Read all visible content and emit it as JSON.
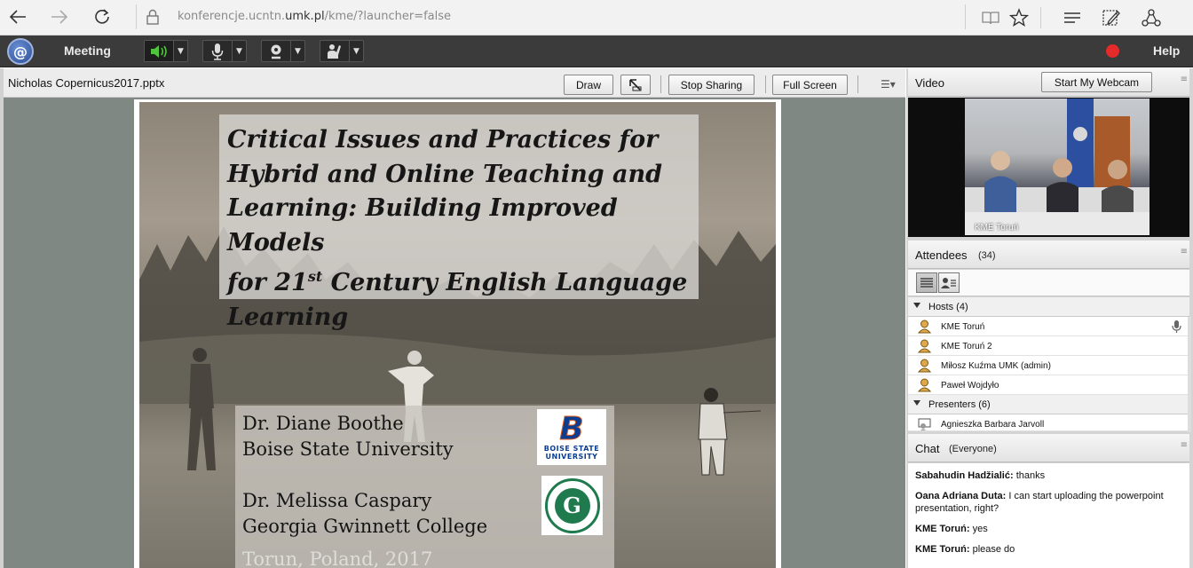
{
  "browser": {
    "url_prefix": "konferencje.ucntn.",
    "url_domain": "umk.pl",
    "url_suffix": "/kme/?launcher=false"
  },
  "meeting_bar": {
    "meeting_label": "Meeting",
    "help_label": "Help",
    "speaker_color": "#4fc43c",
    "record_color": "#e52a2a"
  },
  "share": {
    "file_name": "Nicholas Copernicus2017.pptx",
    "draw_label": "Draw",
    "stop_sharing_label": "Stop Sharing",
    "full_screen_label": "Full Screen",
    "slide": {
      "title_line1": "Critical Issues and Practices for",
      "title_line2": "Hybrid and Online Teaching and",
      "title_line3": "Learning: Building Improved Models",
      "title_line4_a": "for 21",
      "title_line4_sup": "st",
      "title_line4_b": " Century English Language",
      "title_line5": "Learning",
      "presenter1_name": "Dr. Diane Boothe",
      "presenter1_org": "Boise State University",
      "presenter2_name": "Dr. Melissa Caspary",
      "presenter2_org": "Georgia Gwinnett College",
      "location": "Torun, Poland, 2017",
      "bsu_logo_letter": "B",
      "bsu_logo_line1": "BOISE STATE",
      "bsu_logo_line2": "UNIVERSITY",
      "ggc_logo_letter": "G"
    }
  },
  "video": {
    "title": "Video",
    "start_webcam_label": "Start My Webcam",
    "stream_label": "KME Toruń"
  },
  "attendees": {
    "title": "Attendees",
    "count": "(34)",
    "hosts_group": "Hosts (4)",
    "hosts": [
      "KME Toruń",
      "KME Toruń 2",
      "Miłosz Kuźma UMK (admin)",
      "Paweł Wojdyło"
    ],
    "presenters_group": "Presenters (6)",
    "presenters": [
      "Agnieszka Barbara Jarvoll"
    ]
  },
  "chat": {
    "title": "Chat",
    "scope": "(Everyone)",
    "messages": [
      {
        "sender": "Sabahudin  Hadžialić:",
        "text": " thanks"
      },
      {
        "sender": "Oana Adriana Duta:",
        "text": " I can start uploading the powerpoint presentation, right?"
      },
      {
        "sender": "KME Toruń:",
        "text": " yes"
      },
      {
        "sender": "KME Toruń:",
        "text": " please do"
      }
    ]
  }
}
